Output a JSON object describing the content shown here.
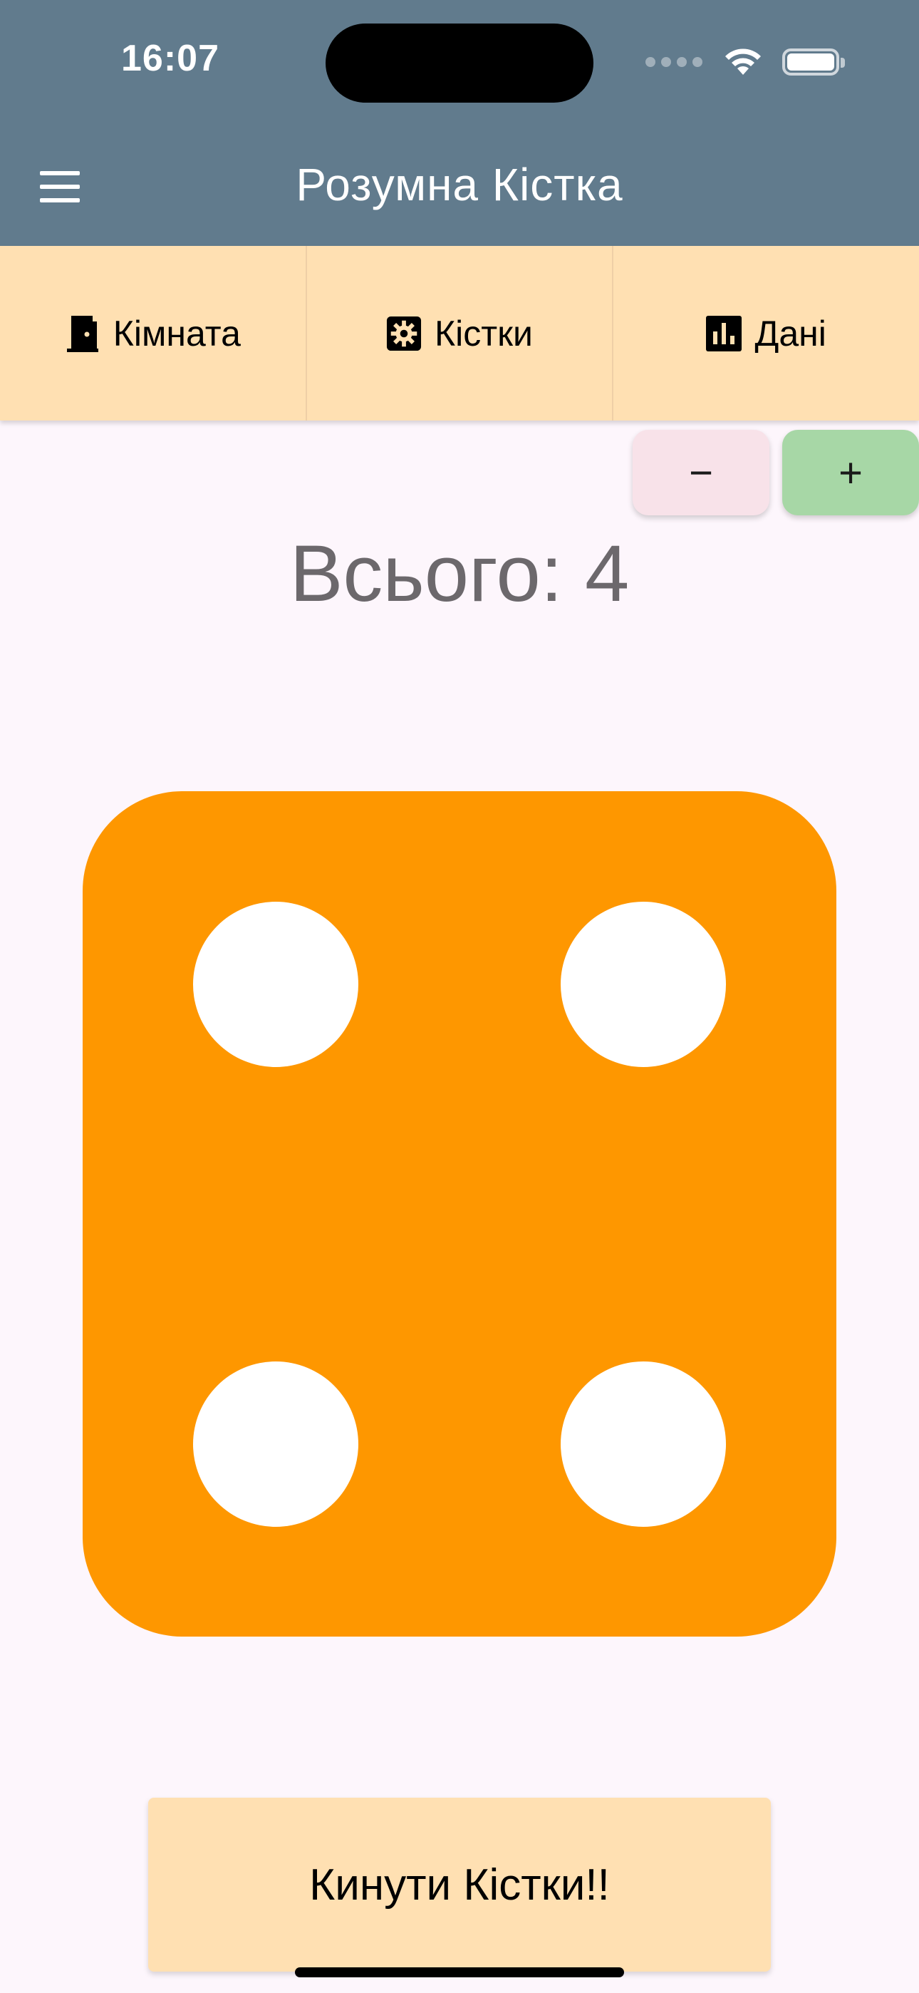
{
  "status_bar": {
    "time": "16:07"
  },
  "app_bar": {
    "title": "Розумна Кістка",
    "menu_icon": "hamburger-menu-icon",
    "background_color": "#617b8d"
  },
  "tabs": [
    {
      "label": "Кімната",
      "icon": "door-icon"
    },
    {
      "label": "Кістки",
      "icon": "gear-icon"
    },
    {
      "label": "Дані",
      "icon": "bar-chart-icon"
    }
  ],
  "controls": {
    "minus_label": "−",
    "plus_label": "+"
  },
  "total": {
    "text": "Всього: 4"
  },
  "die": {
    "value": 4,
    "color": "#fe9700",
    "pip_color": "#ffffff"
  },
  "roll_button": {
    "label": "Кинути Кістки!!"
  },
  "colors": {
    "tab_background": "#ffe0b2",
    "minus_button": "#f8e2e9",
    "plus_button": "#a7d7a6",
    "page_background": "#fdf6fc"
  }
}
